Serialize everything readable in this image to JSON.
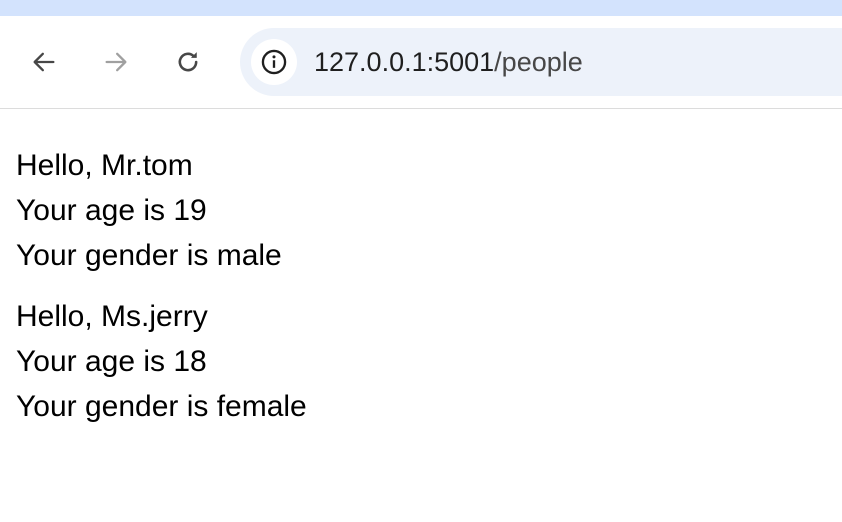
{
  "browser": {
    "url_host": "127.0.0.1:5001",
    "url_path": "/people",
    "icons": {
      "back": "back-arrow-icon",
      "forward": "forward-arrow-icon",
      "reload": "reload-icon",
      "site_info": "info-icon"
    },
    "colors": {
      "tab_strip": "#d3e3fd",
      "omnibox_bg": "#edf2fa",
      "icon_active": "#474747",
      "icon_disabled": "#a0a0a0"
    }
  },
  "page": {
    "people": [
      {
        "greeting": "Hello, Mr.tom",
        "age": "Your age is 19",
        "gender": "Your gender is male"
      },
      {
        "greeting": "Hello, Ms.jerry",
        "age": "Your age is 18",
        "gender": "Your gender is female"
      }
    ]
  }
}
